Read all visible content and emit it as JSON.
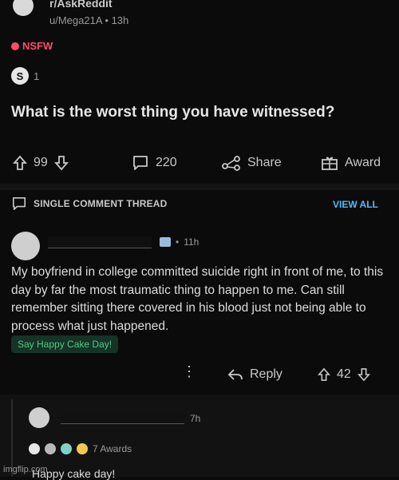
{
  "post": {
    "subreddit": "r/AskReddit",
    "author": "u/Mega21A",
    "age": "13h",
    "nsfw_label": "NSFW",
    "award_count": "1",
    "title": "What is the worst thing you have witnessed?",
    "upvotes": "99",
    "comments": "220",
    "share_label": "Share",
    "award_label": "Award"
  },
  "thread": {
    "label": "SINGLE COMMENT THREAD",
    "view_all": "VIEW ALL"
  },
  "comment": {
    "age": "11h",
    "body": "My boyfriend in college committed suicide right in front of me, to this day by far the most traumatic thing to happen to me. Can still remember sitting there covered in his blood just not being able to process what just happened.",
    "flair": "Say Happy Cake Day!",
    "reply_label": "Reply",
    "score": "42"
  },
  "reply": {
    "age": "7h",
    "awards_label": "7 Awards",
    "body": "Happy cake day!"
  },
  "watermark": "imgflip.com",
  "colors": {
    "nsfw": "#ff4d6d",
    "link": "#4fbcff",
    "flair_bg": "#153326",
    "flair_text": "#52c985"
  }
}
